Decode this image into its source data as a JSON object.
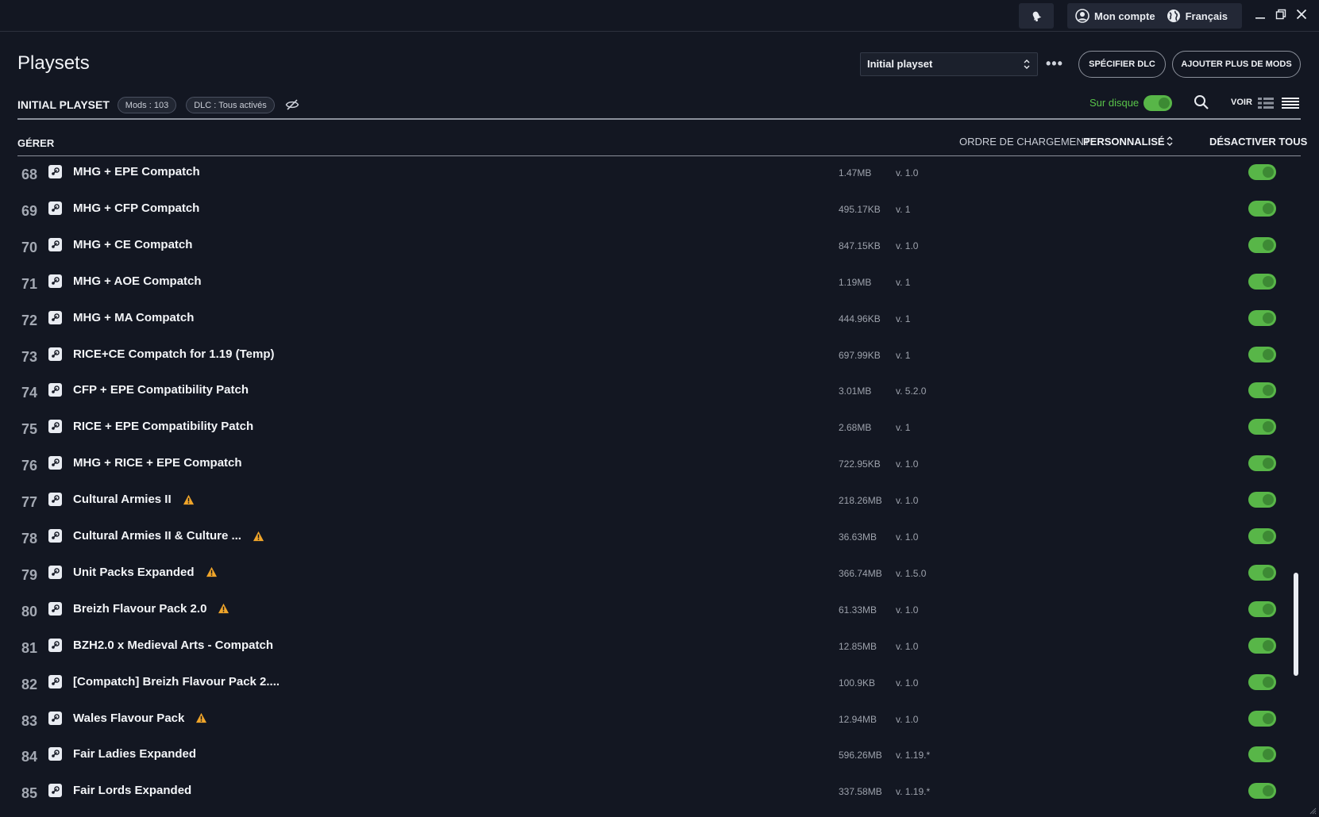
{
  "titlebar": {
    "account_label": "Mon compte",
    "language_label": "Français"
  },
  "header": {
    "title": "Playsets",
    "playset_select_value": "Initial playset",
    "more_label": "•••",
    "specify_dlc_label": "SPÉCIFIER DLC",
    "add_mods_label": "AJOUTER PLUS DE MODS"
  },
  "playset": {
    "name": "INITIAL PLAYSET",
    "mods_badge": "Mods : 103",
    "dlc_badge": "DLC : Tous activés",
    "on_disk_label": "Sur disque",
    "on_disk_enabled": true,
    "view_label": "VOIR"
  },
  "columns": {
    "manage": "GÉRER",
    "load_order_label": "ORDRE DE CHARGEMENT",
    "load_order_value": "PERSONNALISÉ",
    "disable_all": "DÉSACTIVER TOUS"
  },
  "colors": {
    "accent_green": "#58b648",
    "warning": "#f0a52a",
    "background": "#131722"
  },
  "mods": [
    {
      "index": "68",
      "name": "MHG + EPE Compatch",
      "size": "1.47MB",
      "version": "v. 1.0",
      "warning": false,
      "enabled": true
    },
    {
      "index": "69",
      "name": "MHG + CFP Compatch",
      "size": "495.17KB",
      "version": "v. 1",
      "warning": false,
      "enabled": true
    },
    {
      "index": "70",
      "name": "MHG + CE Compatch",
      "size": "847.15KB",
      "version": "v. 1.0",
      "warning": false,
      "enabled": true
    },
    {
      "index": "71",
      "name": "MHG + AOE Compatch",
      "size": "1.19MB",
      "version": "v. 1",
      "warning": false,
      "enabled": true
    },
    {
      "index": "72",
      "name": "MHG + MA Compatch",
      "size": "444.96KB",
      "version": "v. 1",
      "warning": false,
      "enabled": true
    },
    {
      "index": "73",
      "name": "RICE+CE Compatch for 1.19 (Temp)",
      "size": "697.99KB",
      "version": "v. 1",
      "warning": false,
      "enabled": true
    },
    {
      "index": "74",
      "name": "CFP + EPE Compatibility Patch",
      "size": "3.01MB",
      "version": "v. 5.2.0",
      "warning": false,
      "enabled": true
    },
    {
      "index": "75",
      "name": "RICE + EPE Compatibility Patch",
      "size": "2.68MB",
      "version": "v. 1",
      "warning": false,
      "enabled": true
    },
    {
      "index": "76",
      "name": "MHG + RICE + EPE Compatch",
      "size": "722.95KB",
      "version": "v. 1.0",
      "warning": false,
      "enabled": true
    },
    {
      "index": "77",
      "name": "Cultural Armies II",
      "size": "218.26MB",
      "version": "v. 1.0",
      "warning": true,
      "enabled": true
    },
    {
      "index": "78",
      "name": "Cultural Armies II & Culture ...",
      "size": "36.63MB",
      "version": "v. 1.0",
      "warning": true,
      "enabled": true
    },
    {
      "index": "79",
      "name": "Unit Packs Expanded",
      "size": "366.74MB",
      "version": "v. 1.5.0",
      "warning": true,
      "enabled": true
    },
    {
      "index": "80",
      "name": "Breizh Flavour Pack 2.0",
      "size": "61.33MB",
      "version": "v. 1.0",
      "warning": true,
      "enabled": true
    },
    {
      "index": "81",
      "name": "BZH2.0 x Medieval Arts - Compatch",
      "size": "12.85MB",
      "version": "v. 1.0",
      "warning": false,
      "enabled": true
    },
    {
      "index": "82",
      "name": "[Compatch] Breizh Flavour Pack 2....",
      "size": "100.9KB",
      "version": "v. 1.0",
      "warning": false,
      "enabled": true
    },
    {
      "index": "83",
      "name": "Wales Flavour Pack",
      "size": "12.94MB",
      "version": "v. 1.0",
      "warning": true,
      "enabled": true
    },
    {
      "index": "84",
      "name": "Fair Ladies Expanded",
      "size": "596.26MB",
      "version": "v. 1.19.*",
      "warning": false,
      "enabled": true
    },
    {
      "index": "85",
      "name": "Fair Lords Expanded",
      "size": "337.58MB",
      "version": "v. 1.19.*",
      "warning": false,
      "enabled": true
    }
  ]
}
